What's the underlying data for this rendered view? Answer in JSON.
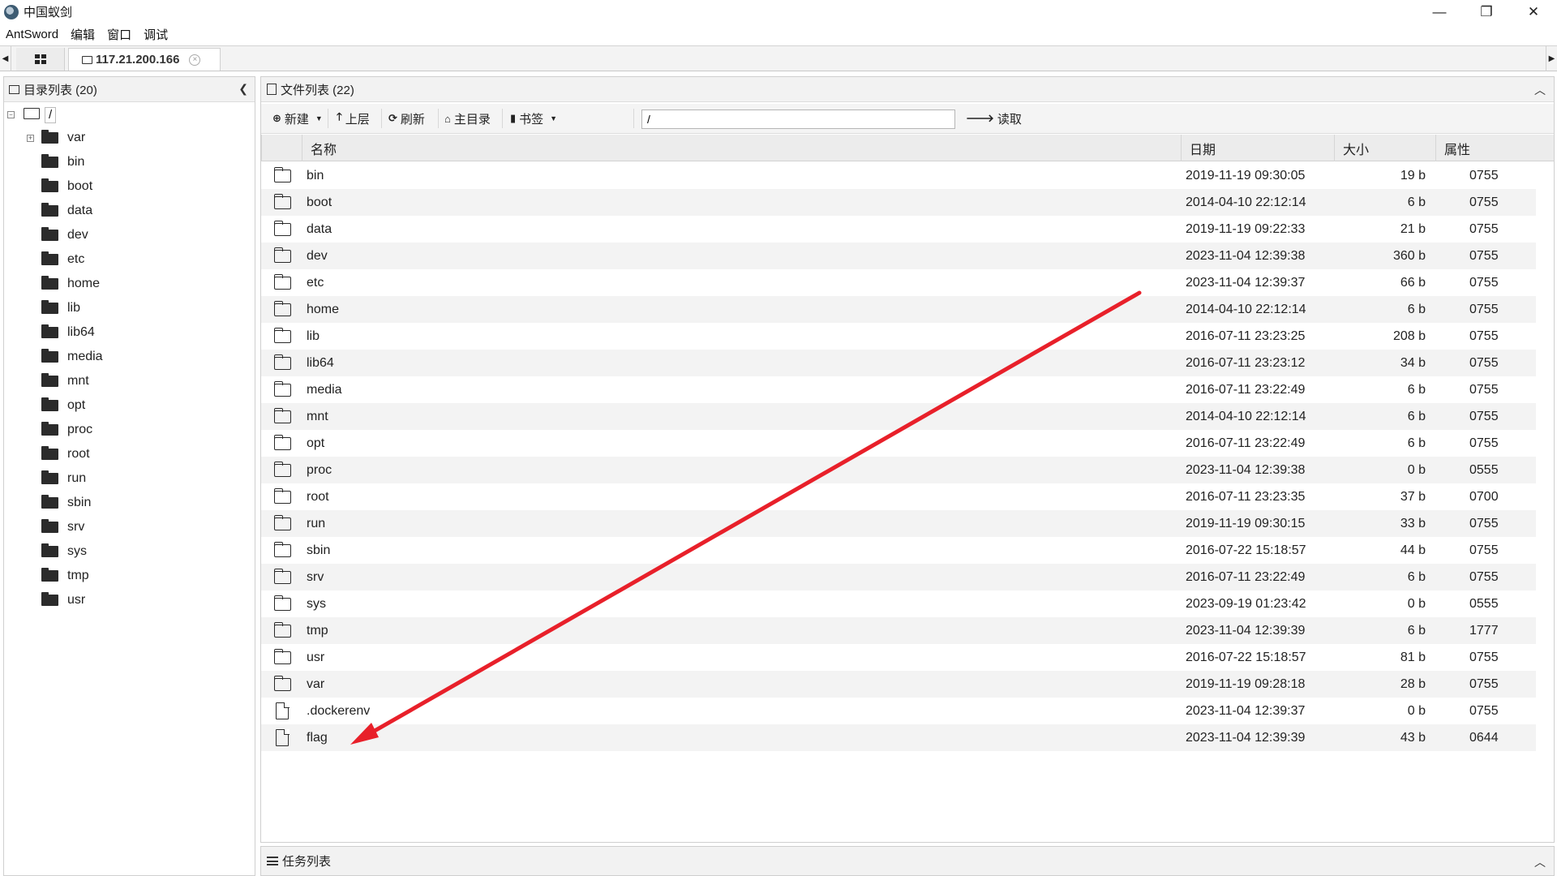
{
  "window": {
    "title": "中国蚁剑",
    "minimize": "—",
    "maximize": "❐",
    "close": "✕"
  },
  "menu": [
    "AntSword",
    "编辑",
    "窗口",
    "调试"
  ],
  "tabs": {
    "active_label": "117.21.200.166",
    "close_glyph": "×"
  },
  "left_panel": {
    "title": "目录列表 (20)",
    "root_label": "/",
    "items": [
      "var",
      "bin",
      "boot",
      "data",
      "dev",
      "etc",
      "home",
      "lib",
      "lib64",
      "media",
      "mnt",
      "opt",
      "proc",
      "root",
      "run",
      "sbin",
      "srv",
      "sys",
      "tmp",
      "usr"
    ]
  },
  "right_panel": {
    "title": "文件列表 (22)",
    "toolbar": {
      "new": "新建",
      "up": "上层",
      "refresh": "刷新",
      "home": "主目录",
      "bookmark": "书签",
      "path_value": "/",
      "read": "读取"
    },
    "columns": {
      "name": "名称",
      "date": "日期",
      "size": "大小",
      "perm": "属性"
    },
    "rows": [
      {
        "type": "folder",
        "name": "bin",
        "date": "2019-11-19 09:30:05",
        "size": "19 b",
        "perm": "0755"
      },
      {
        "type": "folder",
        "name": "boot",
        "date": "2014-04-10 22:12:14",
        "size": "6 b",
        "perm": "0755"
      },
      {
        "type": "folder",
        "name": "data",
        "date": "2019-11-19 09:22:33",
        "size": "21 b",
        "perm": "0755"
      },
      {
        "type": "folder",
        "name": "dev",
        "date": "2023-11-04 12:39:38",
        "size": "360 b",
        "perm": "0755"
      },
      {
        "type": "folder",
        "name": "etc",
        "date": "2023-11-04 12:39:37",
        "size": "66 b",
        "perm": "0755"
      },
      {
        "type": "folder",
        "name": "home",
        "date": "2014-04-10 22:12:14",
        "size": "6 b",
        "perm": "0755"
      },
      {
        "type": "folder",
        "name": "lib",
        "date": "2016-07-11 23:23:25",
        "size": "208 b",
        "perm": "0755"
      },
      {
        "type": "folder",
        "name": "lib64",
        "date": "2016-07-11 23:23:12",
        "size": "34 b",
        "perm": "0755"
      },
      {
        "type": "folder",
        "name": "media",
        "date": "2016-07-11 23:22:49",
        "size": "6 b",
        "perm": "0755"
      },
      {
        "type": "folder",
        "name": "mnt",
        "date": "2014-04-10 22:12:14",
        "size": "6 b",
        "perm": "0755"
      },
      {
        "type": "folder",
        "name": "opt",
        "date": "2016-07-11 23:22:49",
        "size": "6 b",
        "perm": "0755"
      },
      {
        "type": "folder",
        "name": "proc",
        "date": "2023-11-04 12:39:38",
        "size": "0 b",
        "perm": "0555"
      },
      {
        "type": "folder",
        "name": "root",
        "date": "2016-07-11 23:23:35",
        "size": "37 b",
        "perm": "0700"
      },
      {
        "type": "folder",
        "name": "run",
        "date": "2019-11-19 09:30:15",
        "size": "33 b",
        "perm": "0755"
      },
      {
        "type": "folder",
        "name": "sbin",
        "date": "2016-07-22 15:18:57",
        "size": "44 b",
        "perm": "0755"
      },
      {
        "type": "folder",
        "name": "srv",
        "date": "2016-07-11 23:22:49",
        "size": "6 b",
        "perm": "0755"
      },
      {
        "type": "folder",
        "name": "sys",
        "date": "2023-09-19 01:23:42",
        "size": "0 b",
        "perm": "0555"
      },
      {
        "type": "folder",
        "name": "tmp",
        "date": "2023-11-04 12:39:39",
        "size": "6 b",
        "perm": "1777"
      },
      {
        "type": "folder",
        "name": "usr",
        "date": "2016-07-22 15:18:57",
        "size": "81 b",
        "perm": "0755"
      },
      {
        "type": "folder",
        "name": "var",
        "date": "2019-11-19 09:28:18",
        "size": "28 b",
        "perm": "0755"
      },
      {
        "type": "file",
        "name": ".dockerenv",
        "date": "2023-11-04 12:39:37",
        "size": "0 b",
        "perm": "0755"
      },
      {
        "type": "file",
        "name": "flag",
        "date": "2023-11-04 12:39:39",
        "size": "43 b",
        "perm": "0644"
      }
    ]
  },
  "task_panel": {
    "title": "任务列表"
  },
  "colors": {
    "annotation_arrow": "#e8202a"
  }
}
